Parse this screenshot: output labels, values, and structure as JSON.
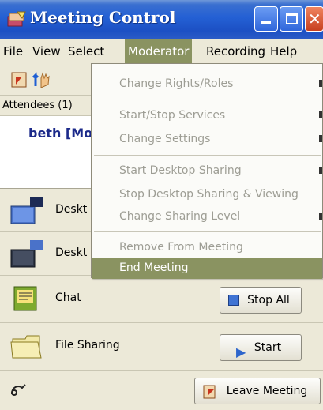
{
  "window": {
    "title": "Meeting Control"
  },
  "menubar": {
    "items": [
      {
        "label": "File"
      },
      {
        "label": "View"
      },
      {
        "label": "Select"
      },
      {
        "label": "Moderator"
      },
      {
        "label": "Recording"
      },
      {
        "label": "Help"
      }
    ],
    "active": "Moderator"
  },
  "toolbar": {
    "icons": [
      "presenter-icon",
      "raise-hand-icon"
    ]
  },
  "attendees": {
    "header": "Attendees (1)",
    "list": [
      {
        "name": "beth [Mo"
      }
    ]
  },
  "services": [
    {
      "label": "Deskt",
      "icon": "desktop-share-icon"
    },
    {
      "label": "Deskt",
      "icon": "desktop-view-icon"
    },
    {
      "label": "Chat",
      "icon": "chat-icon"
    },
    {
      "label": "File Sharing",
      "icon": "folder-icon"
    }
  ],
  "buttons": {
    "stop_all": "Stop All",
    "start": "Start",
    "leave_meeting": "Leave Meeting"
  },
  "moderator_menu": {
    "items": [
      {
        "label": "Change Rights/Roles",
        "enabled": false
      },
      {
        "label": "Start/Stop Services",
        "enabled": false
      },
      {
        "label": "Change Settings",
        "enabled": false
      },
      {
        "label": "Start Desktop Sharing",
        "enabled": false
      },
      {
        "label": "Stop Desktop Sharing & Viewing",
        "enabled": false
      },
      {
        "label": "Change Sharing Level",
        "enabled": false
      },
      {
        "label": "Remove From Meeting",
        "enabled": false
      },
      {
        "label": "End Meeting",
        "enabled": true,
        "highlighted": true
      }
    ]
  },
  "colors": {
    "titlebar": "#2460d4",
    "menu_highlight": "#8a9361",
    "disabled_text": "#9d9d94",
    "attendee_text": "#1c2a8a"
  }
}
